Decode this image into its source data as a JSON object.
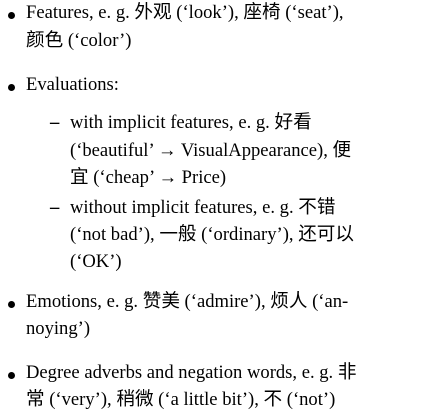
{
  "items": [
    {
      "lines": [
        "Features, e. g. 外观 (‘look’), 座椅 (‘seat’),",
        "颜色 (‘color’)"
      ]
    },
    {
      "lines": [
        "Evaluations:"
      ],
      "subitems": [
        {
          "marker": "–",
          "lines": [
            "with implicit features, e. g.   好看",
            "(‘beautiful’ → VisualAppearance), 便",
            "宜 (‘cheap’ → Price)"
          ]
        },
        {
          "marker": "–",
          "lines": [
            "without implicit features, e. g.  不错",
            "(‘not bad’), 一般 (‘ordinary’), 还可以",
            "(‘OK’)"
          ]
        }
      ]
    },
    {
      "lines": [
        "Emotions, e. g. 赞美 (‘admire’), 烦人 (‘an-",
        "noying’)"
      ]
    },
    {
      "lines": [
        "Degree adverbs and negation words, e. g. 非",
        "常 (‘very’), 稍微 (‘a little bit’), 不 (‘not’)"
      ]
    }
  ]
}
